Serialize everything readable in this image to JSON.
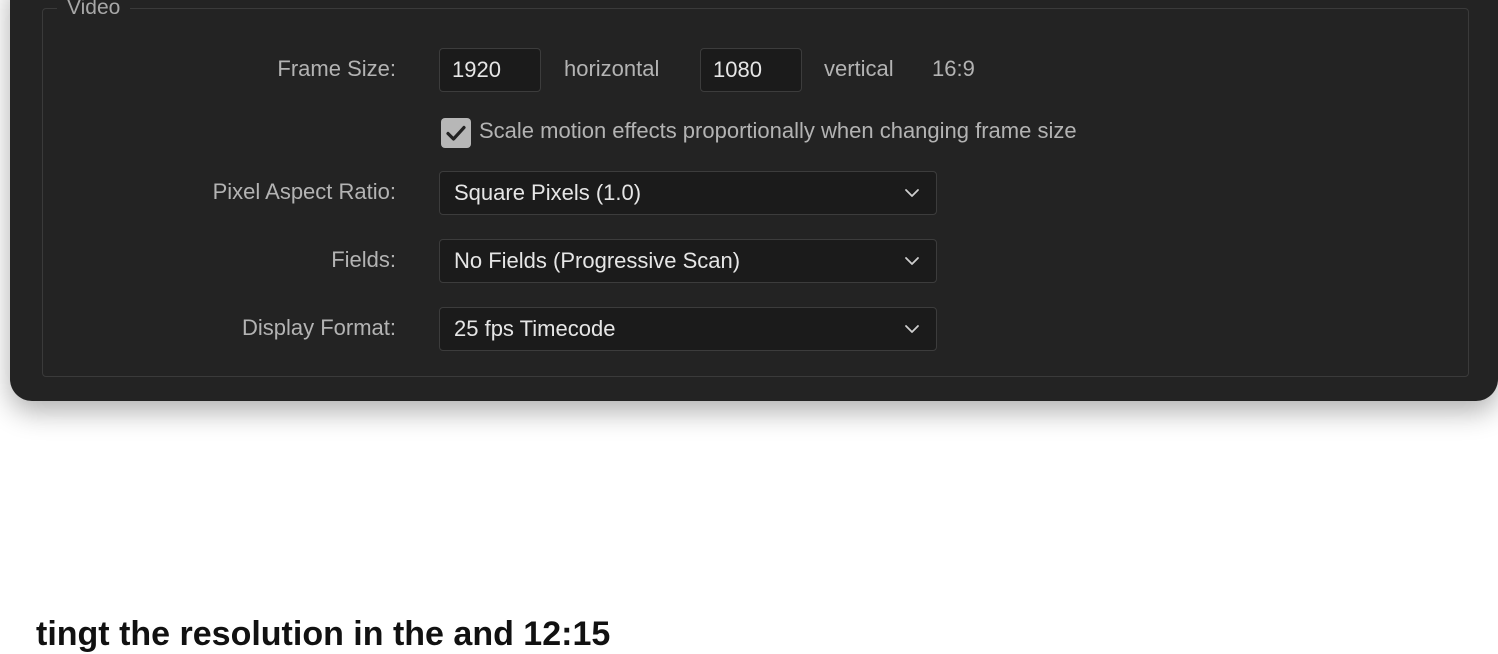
{
  "section": {
    "legend": "Video"
  },
  "frame_size": {
    "label": "Frame Size:",
    "width": "1920",
    "horizontal_label": "horizontal",
    "height": "1080",
    "vertical_label": "vertical",
    "aspect": "16:9"
  },
  "scale_motion": {
    "checked": true,
    "label": "Scale motion effects proportionally when changing frame size"
  },
  "pixel_aspect": {
    "label": "Pixel Aspect Ratio:",
    "value": "Square Pixels (1.0)"
  },
  "fields": {
    "label": "Fields:",
    "value": "No Fields (Progressive Scan)"
  },
  "display_format": {
    "label": "Display Format:",
    "value": "25 fps Timecode"
  },
  "page_text": {
    "partial_heading": "tingt the resolution in the and 12:15"
  },
  "colors": {
    "panel_bg": "#232323",
    "input_bg": "#1b1b1b",
    "text": "#b3b3b3",
    "value_text": "#e6e6e6"
  },
  "icons": {
    "checkbox": "checkmark-icon",
    "dropdown": "chevron-down-icon"
  }
}
